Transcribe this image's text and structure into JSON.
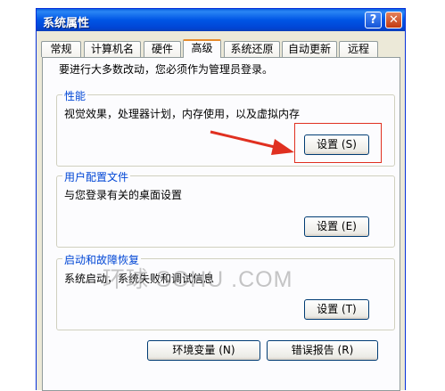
{
  "window": {
    "title": "系统属性",
    "help_label": "?",
    "close_label": "✕"
  },
  "tabs": [
    {
      "label": "常规"
    },
    {
      "label": "计算机名"
    },
    {
      "label": "硬件"
    },
    {
      "label": "高级",
      "active": true
    },
    {
      "label": "系统还原"
    },
    {
      "label": "自动更新"
    },
    {
      "label": "远程"
    }
  ],
  "admin_note": "要进行大多数改动，您必须作为管理员登录。",
  "performance": {
    "title": "性能",
    "description": "视觉效果，处理器计划，内存使用，以及虚拟内存",
    "button": "设置 (S)"
  },
  "user_profiles": {
    "title": "用户配置文件",
    "description": "与您登录有关的桌面设置",
    "button": "设置 (E)"
  },
  "startup_recovery": {
    "title": "启动和故障恢复",
    "description": "系统启动，系统失败和调试信息",
    "button": "设置 (T)"
  },
  "footer_buttons": {
    "env_vars": "环境变量 (N)",
    "error_report": "错误报告 (R)"
  },
  "watermark": "环球 SOHU .COM",
  "colors": {
    "titlebar": "#0055e5",
    "active_tab_accent": "#e68b2c",
    "group_title": "#0046d5",
    "annotation": "#e03020"
  }
}
